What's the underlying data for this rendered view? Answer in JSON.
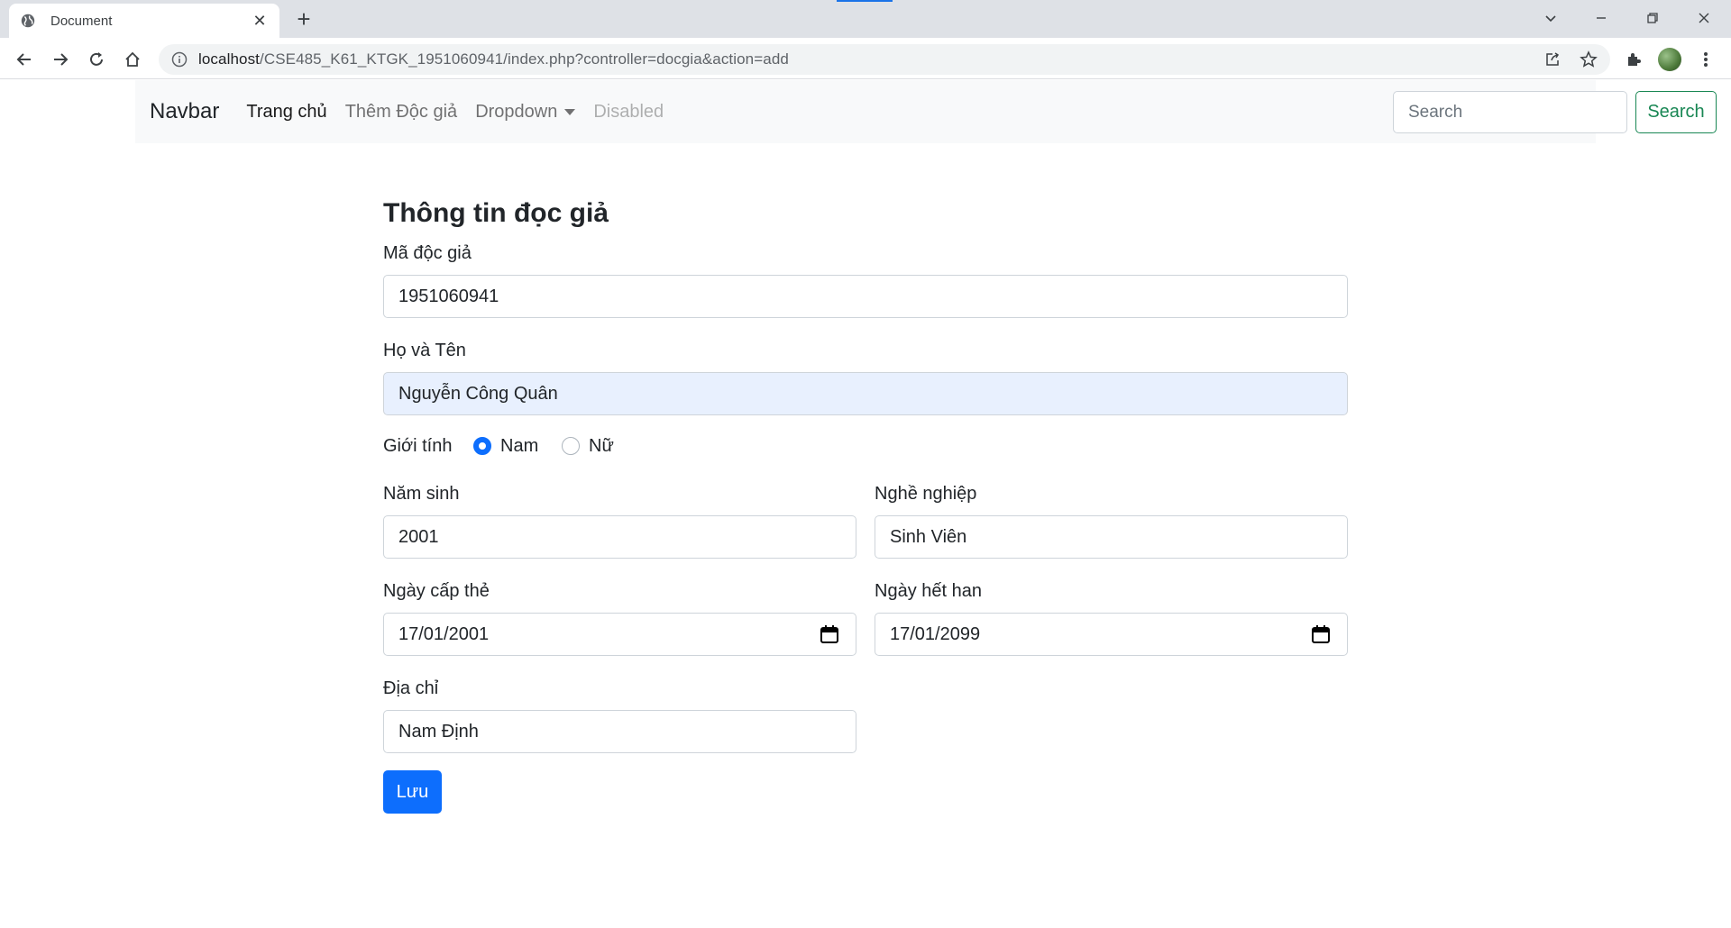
{
  "browser": {
    "tab_title": "Document",
    "url_host": "localhost",
    "url_path": "/CSE485_K61_KTGK_1951060941/index.php?controller=docgia&action=add"
  },
  "navbar": {
    "brand": "Navbar",
    "links": [
      "Trang chủ",
      "Thêm Độc giả",
      "Dropdown",
      "Disabled"
    ],
    "search_placeholder": "Search",
    "search_button": "Search"
  },
  "form": {
    "heading": "Thông tin đọc giả",
    "ma_doc_gia": {
      "label": "Mã độc giả",
      "value": "1951060941"
    },
    "ho_ten": {
      "label": "Họ và Tên",
      "value": "Nguyễn Công Quân"
    },
    "gioi_tinh": {
      "label": "Giới tính",
      "options": [
        "Nam",
        "Nữ"
      ],
      "selected": "Nam"
    },
    "nam_sinh": {
      "label": "Năm sinh",
      "value": "2001"
    },
    "nghe_nghiep": {
      "label": "Nghề nghiệp",
      "value": "Sinh Viên"
    },
    "ngay_cap_the": {
      "label": "Ngày cấp thẻ",
      "value": "17/01/2001"
    },
    "ngay_het_han": {
      "label": "Ngày hết han",
      "value": "17/01/2099"
    },
    "dia_chi": {
      "label": "Địa chỉ",
      "value": "Nam Định"
    },
    "save_button": "Lưu"
  },
  "colors": {
    "primary": "#0d6efd",
    "success": "#198754",
    "autofill": "#e8f0fe"
  }
}
